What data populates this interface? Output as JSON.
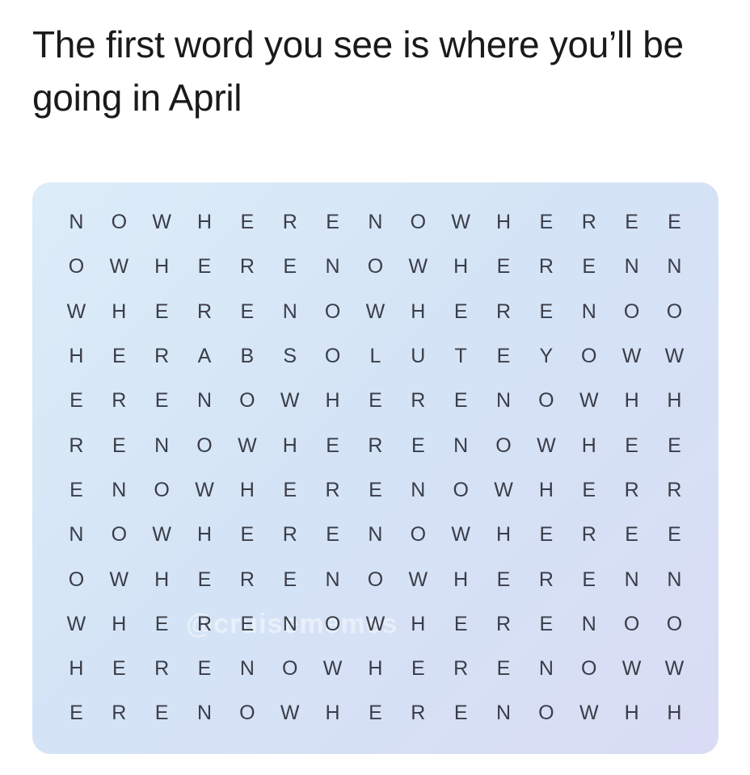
{
  "caption": "The first word you see is where you’ll be going in April",
  "watermark": "@cruisememes",
  "grid": [
    [
      "N",
      "O",
      "W",
      "H",
      "E",
      "R",
      "E",
      "N",
      "O",
      "W",
      "H",
      "E",
      "R",
      "E",
      "E"
    ],
    [
      "O",
      "W",
      "H",
      "E",
      "R",
      "E",
      "N",
      "O",
      "W",
      "H",
      "E",
      "R",
      "E",
      "N",
      "N"
    ],
    [
      "W",
      "H",
      "E",
      "R",
      "E",
      "N",
      "O",
      "W",
      "H",
      "E",
      "R",
      "E",
      "N",
      "O",
      "O"
    ],
    [
      "H",
      "E",
      "R",
      "A",
      "B",
      "S",
      "O",
      "L",
      "U",
      "T",
      "E",
      "Y",
      "O",
      "W",
      "W"
    ],
    [
      "E",
      "R",
      "E",
      "N",
      "O",
      "W",
      "H",
      "E",
      "R",
      "E",
      "N",
      "O",
      "W",
      "H",
      "H"
    ],
    [
      "R",
      "E",
      "N",
      "O",
      "W",
      "H",
      "E",
      "R",
      "E",
      "N",
      "O",
      "W",
      "H",
      "E",
      "E"
    ],
    [
      "E",
      "N",
      "O",
      "W",
      "H",
      "E",
      "R",
      "E",
      "N",
      "O",
      "W",
      "H",
      "E",
      "R",
      "R"
    ],
    [
      "N",
      "O",
      "W",
      "H",
      "E",
      "R",
      "E",
      "N",
      "O",
      "W",
      "H",
      "E",
      "R",
      "E",
      "E"
    ],
    [
      "O",
      "W",
      "H",
      "E",
      "R",
      "E",
      "N",
      "O",
      "W",
      "H",
      "E",
      "R",
      "E",
      "N",
      "N"
    ],
    [
      "W",
      "H",
      "E",
      "R",
      "E",
      "N",
      "O",
      "W",
      "H",
      "E",
      "R",
      "E",
      "N",
      "O",
      "O"
    ],
    [
      "H",
      "E",
      "R",
      "E",
      "N",
      "O",
      "W",
      "H",
      "E",
      "R",
      "E",
      "N",
      "O",
      "W",
      "W"
    ],
    [
      "E",
      "R",
      "E",
      "N",
      "O",
      "W",
      "H",
      "E",
      "R",
      "E",
      "N",
      "O",
      "W",
      "H",
      "H"
    ]
  ]
}
